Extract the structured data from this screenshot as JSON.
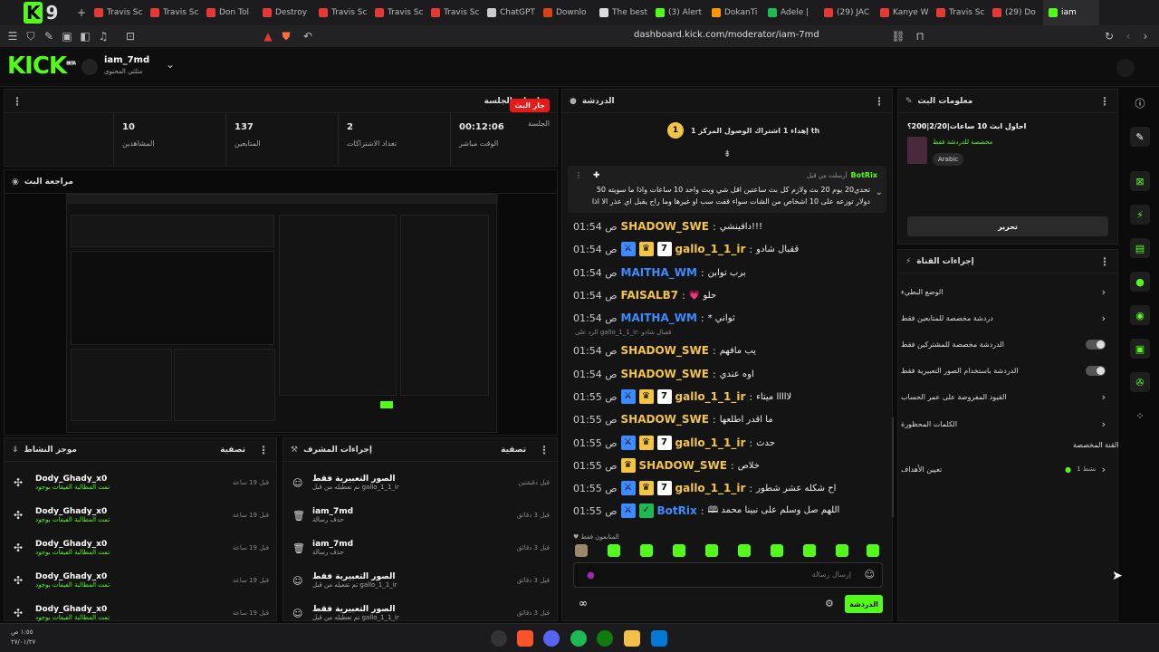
{
  "browser": {
    "tabs": [
      {
        "label": "Travis Sc",
        "color": "#e53935"
      },
      {
        "label": "Travis Sc",
        "color": "#e53935"
      },
      {
        "label": "Don Tol",
        "color": "#e53935"
      },
      {
        "label": "Destroy",
        "color": "#e53935"
      },
      {
        "label": "Travis Sc",
        "color": "#e53935"
      },
      {
        "label": "Travis Sc",
        "color": "#e53935"
      },
      {
        "label": "Travis Sc",
        "color": "#e53935"
      },
      {
        "label": "ChatGPT",
        "color": "#cccccc"
      },
      {
        "label": "Downlo",
        "color": "#d84315"
      },
      {
        "label": "The best",
        "color": "#dddddd"
      },
      {
        "label": "(3) Alert",
        "color": "#53fc18"
      },
      {
        "label": "DokanTi",
        "color": "#ff9800"
      },
      {
        "label": "Adele |",
        "color": "#1db954"
      },
      {
        "label": "(29) JAC",
        "color": "#e53935"
      },
      {
        "label": "Kanye W",
        "color": "#e53935"
      },
      {
        "label": "Travis Sc",
        "color": "#e53935"
      },
      {
        "label": "(29) Do",
        "color": "#e53935"
      },
      {
        "label": "iam",
        "color": "#53fc18"
      }
    ],
    "new_tab_symbol": "+",
    "url": "dashboard.kick.com/moderator/iam-7md"
  },
  "header": {
    "logo": "KICK",
    "logo_sup": "BETA",
    "username": "iam_7md",
    "user_sub": "مثلثي المحتوى"
  },
  "session": {
    "title": "معلومات الجلسة",
    "live_badge": "جار البث",
    "live_label": "الجلسة",
    "stats": [
      {
        "value": "10",
        "label": "المشاهدين"
      },
      {
        "value": "137",
        "label": "المتابعين"
      },
      {
        "value": "2",
        "label": "تعداد الاشتراكات"
      },
      {
        "value": "00:12:06",
        "label": "الوقت مباشر"
      }
    ]
  },
  "preview": {
    "title": "مراجعة البث"
  },
  "activity": {
    "title": "موجز النشاط",
    "filter": "تصفية",
    "items": [
      {
        "name": "Dody_Ghady_x0",
        "sub": "تمت المطالبة الفيفات بوجود",
        "ago": "قبل 19 ساعة"
      },
      {
        "name": "Dody_Ghady_x0",
        "sub": "تمت المطالبة الفيفات بوجود",
        "ago": "قبل 19 ساعة"
      },
      {
        "name": "Dody_Ghady_x0",
        "sub": "تمت المطالبة الفيفات بوجود",
        "ago": "قبل 19 ساعة"
      },
      {
        "name": "Dody_Ghady_x0",
        "sub": "تمت المطالبة الفيفات بوجود",
        "ago": "قبل 19 ساعة"
      },
      {
        "name": "Dody_Ghady_x0",
        "sub": "تمت المطالبة الفيفات بوجود",
        "ago": "قبل 19 ساعة"
      }
    ]
  },
  "modactions": {
    "title": "إجراءات المشرف",
    "filter": "تصفية",
    "items": [
      {
        "name": "الصور التعبيرية فقط",
        "sub": "تم تعطيله من قبل gallo_1_1_ir",
        "ago": "قبل دقيقتين"
      },
      {
        "name": "iam_7md",
        "sub": "حذف رسالة",
        "ago": "قبل 3 دقائق"
      },
      {
        "name": "iam_7md",
        "sub": "حذف رسالة",
        "ago": "قبل 3 دقائق"
      },
      {
        "name": "الصور التعبيرية فقط",
        "sub": "تم تفعيله من قبل gallo_1_1_ir",
        "ago": "قبل 3 دقائق"
      },
      {
        "name": "الصور التعبيرية فقط",
        "sub": "تم تعطيله من قبل gallo_1_1_ir",
        "ago": "قبل 3 دقائق"
      }
    ]
  },
  "chat": {
    "title": "الدردشة",
    "goal_count": "1",
    "goal_text": "إهداء 1 اشتراك الوصول المركز 1 th",
    "pinned_by": "أرسلت من قبل",
    "pinned_user": "BotRix",
    "pinned_text": "تحدي20 يوم 20 بث ولازم كل بث ساعتين اقل شي وبث واحد 10 ساعات واذا ما سويته 50 دولار توزعه على 10 اشخاص من الشات سواء قفت سب او غيرها وما راح يقبل اي عذر الا اذا كان عطر",
    "messages": [
      {
        "time": "01:54 ص",
        "user": "SHADOW_SWE",
        "color": "#f4c542",
        "badges": [],
        "text": "!!!دافينشي"
      },
      {
        "time": "01:54 ص",
        "user": "gallo_1_1_ir",
        "color": "#f4c542",
        "badges": [
          "sword",
          "crown",
          "seven"
        ],
        "text": "ققبال شادو"
      },
      {
        "time": "01:54 ص",
        "user": "MAITHA_WM",
        "color": "#3d8bff",
        "badges": [],
        "text": "برب توابن"
      },
      {
        "time": "01:54 ص",
        "user": "FAISALB7",
        "color": "#f4c542",
        "badges": [],
        "text": "حلو 💗"
      },
      {
        "time": "01:54 ص",
        "user": "MAITHA_WM",
        "color": "#3d8bff",
        "badges": [],
        "text": "ثواني *"
      },
      {
        "time": "01:54 ص",
        "user": "SHADOW_SWE",
        "color": "#f4c542",
        "badges": [],
        "text": "يب مافهم",
        "reply": "الرد على gallo_1_1_ir: ققبال شادو"
      },
      {
        "time": "01:54 ص",
        "user": "SHADOW_SWE",
        "color": "#f4c542",
        "badges": [],
        "text": "اوه عندي"
      },
      {
        "time": "01:55 ص",
        "user": "gallo_1_1_ir",
        "color": "#f4c542",
        "badges": [
          "sword",
          "crown",
          "seven"
        ],
        "text": "لااااا ميتاء"
      },
      {
        "time": "01:55 ص",
        "user": "SHADOW_SWE",
        "color": "#f4c542",
        "badges": [],
        "text": "ما اقدر اطلعها"
      },
      {
        "time": "01:55 ص",
        "user": "gallo_1_1_ir",
        "color": "#f4c542",
        "badges": [
          "sword",
          "crown",
          "seven"
        ],
        "text": "حدث"
      },
      {
        "time": "01:55 ص",
        "user": "SHADOW_SWE",
        "color": "#f4c542",
        "badges": [
          "crown"
        ],
        "text": "خلاص"
      },
      {
        "time": "01:55 ص",
        "user": "gallo_1_1_ir",
        "color": "#f4c542",
        "badges": [
          "sword",
          "crown",
          "seven"
        ],
        "text": "اح شكله عشر شطور"
      },
      {
        "time": "01:55 ص",
        "user": "BotRix",
        "color": "#3d8bff",
        "badges": [
          "sword",
          "check"
        ],
        "text": "اللهم صل وسلم على نبينا محمد 🕮"
      }
    ],
    "followers_only_label": "المتابعون فقط",
    "input_placeholder": "إرسال رسالة",
    "send_label": "الدردشة"
  },
  "stream_info": {
    "title": "معلومات البث",
    "stream_title": "احاول ابث 10 ساعات|2/20|200؟",
    "category": "مخصصة للدردشة فقط",
    "language": "Arabic",
    "edit_label": "تحرير"
  },
  "channel_actions": {
    "title": "إجراءات القناة",
    "rows": [
      {
        "label": "الوضع البطيء",
        "control": "chevron"
      },
      {
        "label": "دردشة مخصصة للمتابعين فقط",
        "control": "chevron"
      },
      {
        "label": "الدردشة مخصصة للمشتركين فقط",
        "control": "toggle"
      },
      {
        "label": "الدردشة باستخدام الصور التعبيرية فقط",
        "control": "toggle"
      },
      {
        "label": "القيود المفروضة على عمر الحساب",
        "control": "chevron"
      },
      {
        "label": "الكلمات المحظورة",
        "control": "chevron"
      }
    ],
    "custom_words": "القنة المخصصة",
    "goals_label": "تعيين الأهداف",
    "goals_value": "نشط 1"
  },
  "taskbar": {
    "time": "١:٥٥ ص",
    "date": "٢٧/٠١/٢٧"
  },
  "colors": {
    "accent": "#53fc18",
    "live": "#e91916"
  }
}
